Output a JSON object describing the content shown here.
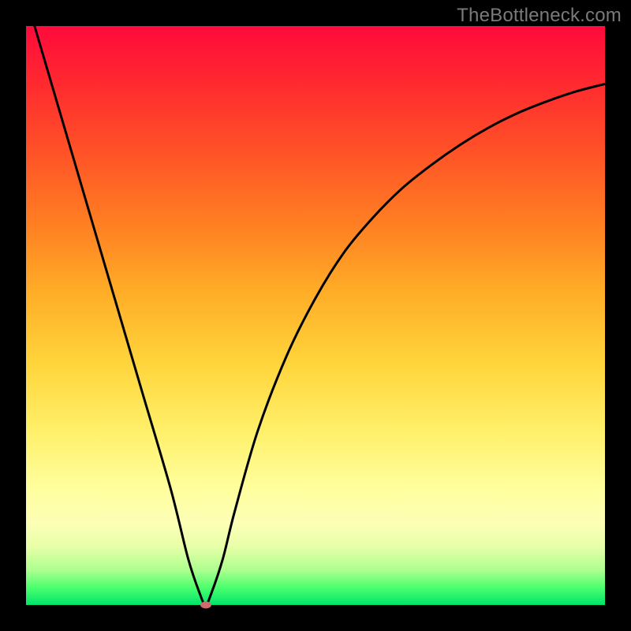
{
  "watermark": "TheBottleneck.com",
  "colors": {
    "gradient_top": "#ff0a3c",
    "gradient_bottom": "#00e56a",
    "curve": "#000000",
    "marker": "#cf6a6f",
    "frame_bg": "#000000"
  },
  "chart_data": {
    "type": "line",
    "title": "",
    "xlabel": "",
    "ylabel": "",
    "xlim": [
      0,
      100
    ],
    "ylim": [
      0,
      100
    ],
    "annotations": [
      {
        "text": "TheBottleneck.com",
        "x": 100,
        "y": 100,
        "anchor": "top-right"
      }
    ],
    "series": [
      {
        "name": "bottleneck-curve",
        "x": [
          0,
          5,
          10,
          15,
          20,
          25,
          28,
          30,
          31,
          32,
          34,
          36,
          40,
          45,
          50,
          55,
          60,
          65,
          70,
          75,
          80,
          85,
          90,
          95,
          100
        ],
        "values": [
          105,
          88,
          71,
          54,
          37,
          20,
          8,
          2,
          0,
          2,
          8,
          16,
          30,
          43,
          53,
          61,
          67,
          72,
          76,
          79.5,
          82.5,
          85,
          87,
          88.7,
          90
        ]
      }
    ],
    "marker": {
      "x": 31,
      "y": 0
    }
  }
}
